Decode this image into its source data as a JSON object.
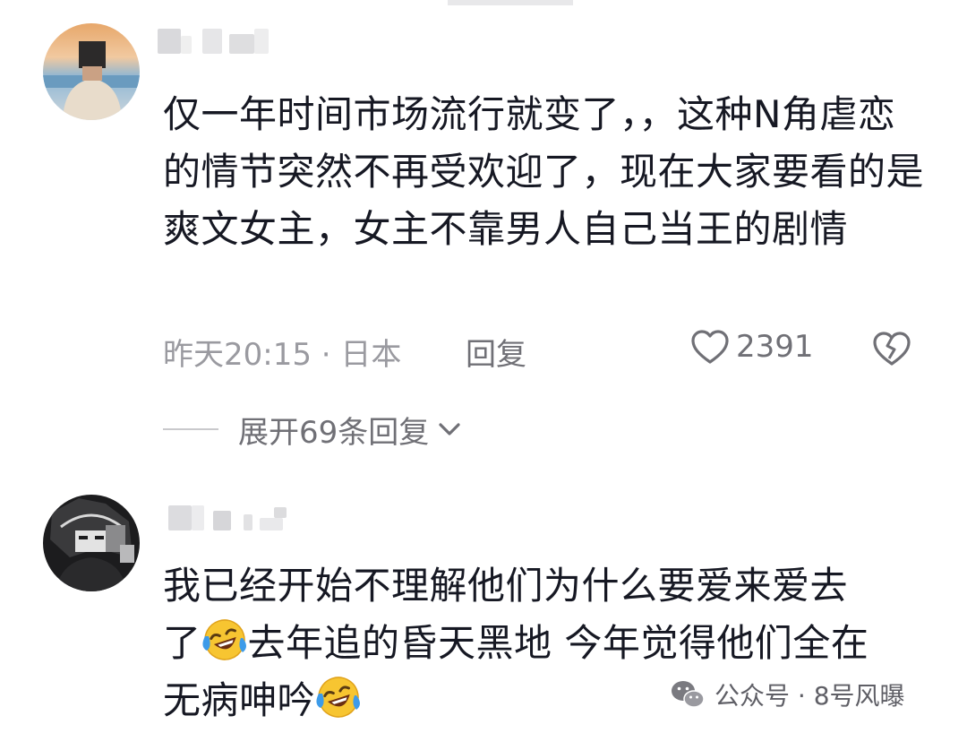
{
  "comments": [
    {
      "text": "仅一年时间市场流行就变了，，这种N角虐恋的情节突然不再受欢迎了，现在大家要看的是爽文女主，女主不靠男人自己当王的剧情",
      "time_location": "昨天20:15 · 日本",
      "reply_label": "回复",
      "like_count": "2391",
      "expand_label": "展开69条回复"
    },
    {
      "text_line1": "我已经开始不理解他们为什么要爱来爱去",
      "text_part2a": "了",
      "text_part2b": "去年追的昏天黑地 今年觉得他们全在",
      "text_part3": "无病呻吟"
    }
  ],
  "watermark": {
    "text": "公众号 · 8号风曝"
  },
  "icons": {
    "like": "heart-outline-icon",
    "dislike": "broken-heart-icon",
    "expand": "chevron-down-icon",
    "emoji": "laughing-crying-emoji-icon",
    "watermark": "wechat-icon"
  }
}
